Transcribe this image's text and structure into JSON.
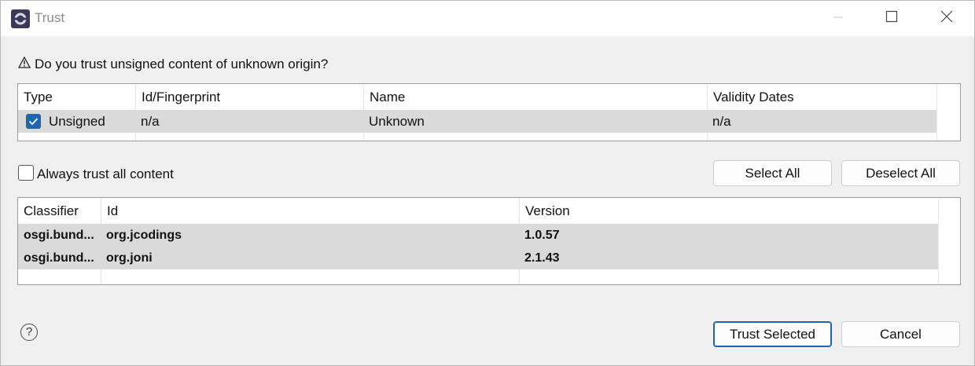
{
  "window": {
    "title": "Trust",
    "icon": "eclipse-icon"
  },
  "question": {
    "icon": "warning-icon",
    "text": "Do you trust unsigned content of unknown origin?"
  },
  "certificates_table": {
    "columns": [
      "Type",
      "Id/Fingerprint",
      "Name",
      "Validity Dates"
    ],
    "rows": [
      {
        "checked": true,
        "type": "Unsigned",
        "id": "n/a",
        "name": "Unknown",
        "validity": "n/a"
      }
    ]
  },
  "always_trust": {
    "label": "Always trust all content",
    "checked": false
  },
  "buttons": {
    "select_all": "Select All",
    "deselect_all": "Deselect All",
    "trust_selected": "Trust Selected",
    "cancel": "Cancel"
  },
  "artifacts_table": {
    "columns": [
      "Classifier",
      "Id",
      "Version"
    ],
    "rows": [
      {
        "classifier": "osgi.bund...",
        "id": "org.jcodings",
        "version": "1.0.57"
      },
      {
        "classifier": "osgi.bund...",
        "id": "org.joni",
        "version": "2.1.43"
      }
    ]
  },
  "help": {
    "icon": "help-icon",
    "glyph": "?"
  }
}
